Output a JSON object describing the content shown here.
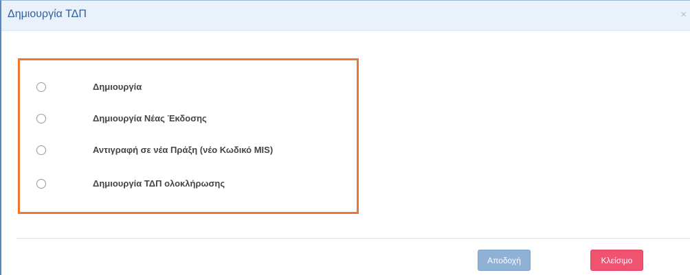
{
  "dialog": {
    "title": "Δημιουργία ΤΔΠ",
    "close_glyph": "×"
  },
  "options": [
    {
      "label": "Δημιουργία",
      "selected": false
    },
    {
      "label": "Δημιουργία Νέας Έκδοσης",
      "selected": false
    },
    {
      "label": "Αντιγραφή σε νέα Πράξη (νέο Κωδικό MIS)",
      "selected": false
    },
    {
      "label": "Δημιουργία ΤΔΠ ολοκλήρωσης",
      "selected": false
    }
  ],
  "footer": {
    "accept_label": "Αποδοχή",
    "close_label": "Κλείσιμο"
  },
  "colors": {
    "header_bg": "#e9f1fb",
    "title_text": "#2f5f9e",
    "highlight_frame": "#ef7530",
    "accept_button": "#8fb1d6",
    "close_button": "#f0536f"
  }
}
